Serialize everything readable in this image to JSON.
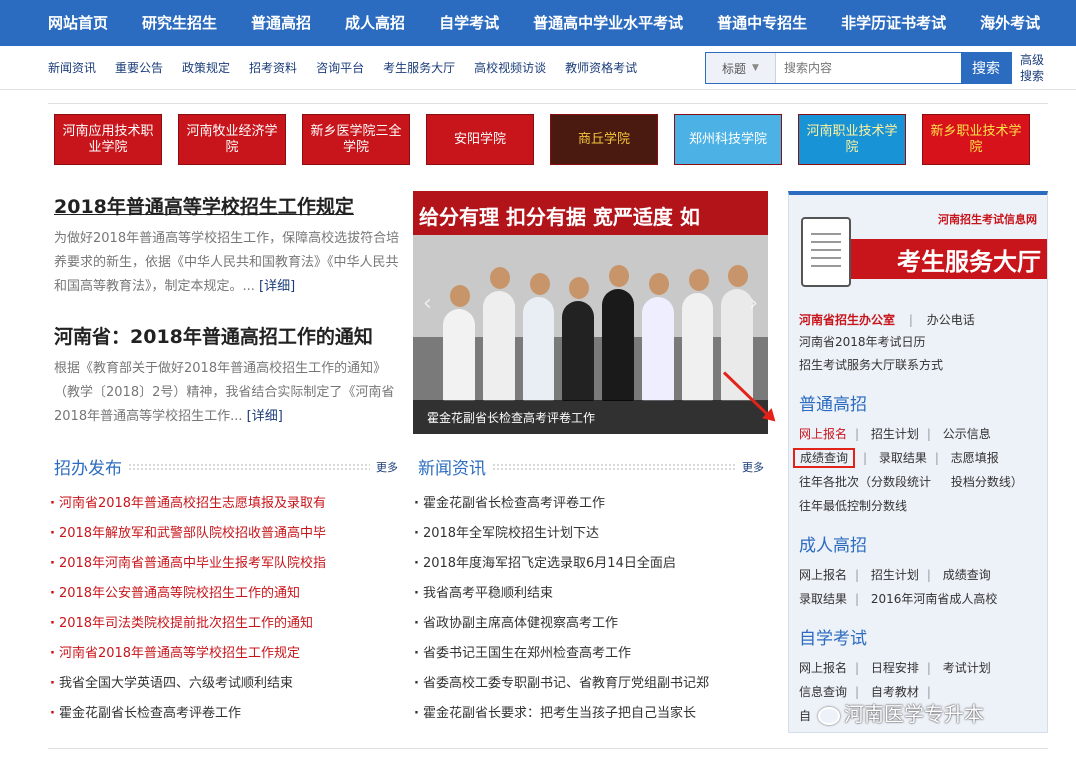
{
  "topnav": [
    "网站首页",
    "研究生招生",
    "普通高招",
    "成人高招",
    "自学考试",
    "普通高中学业水平考试",
    "普通中专招生",
    "非学历证书考试",
    "海外考试"
  ],
  "subnav": [
    "新闻资讯",
    "重要公告",
    "政策规定",
    "招考资料",
    "咨询平台",
    "考生服务大厅",
    "高校视频访谈",
    "教师资格考试"
  ],
  "search": {
    "select": "标题",
    "placeholder": "搜索内容",
    "button": "搜索",
    "advanced": "高级搜索"
  },
  "logos": [
    "河南应用技术职业学院",
    "河南牧业经济学院",
    "新乡医学院三全学院",
    "安阳学院",
    "商丘学院",
    "郑州科技学院",
    "河南职业技术学院",
    "新乡职业技术学院"
  ],
  "articles": [
    {
      "title": "2018年普通高等学校招生工作规定",
      "body": "为做好2018年普通高等学校招生工作，保障高校选拔符合培养要求的新生，依据《中华人民共和国教育法》《中华人民共和国高等教育法》，制定本规定。...",
      "more": "[详细]"
    },
    {
      "title": "河南省：2018年普通高招工作的通知",
      "body": "根据《教育部关于做好2018年普通高校招生工作的通知》（教学〔2018〕2号）精神，我省结合实际制定了《河南省2018年普通高等学校招生工作...",
      "more": "[详细]"
    }
  ],
  "photo": {
    "banner": "给分有理 扣分有据 宽严适度 如",
    "caption": "霍金花副省长检查高考评卷工作"
  },
  "zhaoban": {
    "title": "招办发布",
    "more": "更多",
    "items": [
      "河南省2018年普通高校招生志愿填报及录取有",
      "2018年解放军和武警部队院校招收普通高中毕",
      "2018年河南省普通高中毕业生报考军队院校指",
      "2018年公安普通高等院校招生工作的通知",
      "2018年司法类院校提前批次招生工作的通知",
      "河南省2018年普通高等学校招生工作规定",
      "我省全国大学英语四、六级考试顺利结束",
      "霍金花副省长检查高考评卷工作"
    ]
  },
  "news": {
    "title": "新闻资讯",
    "more": "更多",
    "items": [
      "霍金花副省长检查高考评卷工作",
      "2018年全军院校招生计划下达",
      "2018年度海军招飞定选录取6月14日全面启",
      "我省高考平稳顺利结束",
      "省政协副主席高体健视察高考工作",
      "省委书记王国生在郑州检查高考工作",
      "省委高校工委专职副书记、省教育厅党组副书记郑",
      "霍金花副省长要求：把考生当孩子把自己当家长"
    ]
  },
  "panel": {
    "site": "河南招生考试信息网",
    "hall": "考生服务大厅",
    "office": "河南省招生办公室",
    "phone": "办公电话",
    "calendar": "河南省2018年考试日历",
    "contact": "招生考试服务大厅联系方式",
    "pg_title": "普通高招",
    "pg": [
      "网上报名",
      "招生计划",
      "公示信息",
      "成绩查询",
      "录取结果",
      "志愿填报",
      "往年各批次（分数段统计",
      "投档分数线）",
      "往年最低控制分数线"
    ],
    "cr_title": "成人高招",
    "cr": [
      "网上报名",
      "招生计划",
      "成绩查询",
      "录取结果",
      "2016年河南省成人高校"
    ],
    "zk_title": "自学考试",
    "zk": [
      "网上报名",
      "日程安排",
      "考试计划",
      "信息查询",
      "自考教材",
      "自"
    ]
  },
  "watermark": "河南医学专升本"
}
